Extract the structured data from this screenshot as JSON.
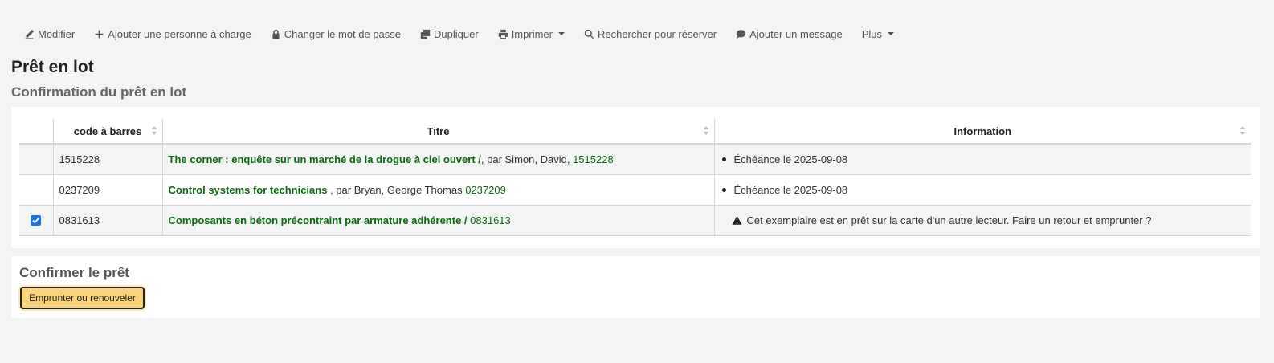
{
  "toolbar": {
    "items": [
      {
        "label": "Modifier",
        "icon": "pencil-icon"
      },
      {
        "label": "Ajouter une personne à charge",
        "icon": "plus-icon"
      },
      {
        "label": "Changer le mot de passe",
        "icon": "lock-icon"
      },
      {
        "label": "Dupliquer",
        "icon": "copy-icon"
      },
      {
        "label": "Imprimer",
        "icon": "print-icon"
      },
      {
        "label": "Rechercher pour réserver",
        "icon": "search-icon"
      },
      {
        "label": "Ajouter un message",
        "icon": "comment-icon"
      },
      {
        "label": "Plus"
      }
    ]
  },
  "page": {
    "title": "Prêt en lot",
    "subtitle": "Confirmation du prêt en lot"
  },
  "table": {
    "headers": [
      "code à barres",
      "Titre",
      "Information"
    ],
    "rows": [
      {
        "checked": false,
        "barcode": "1515228",
        "title": "The corner : enquête sur un marché de la drogue à ciel ouvert /",
        "author": ", par Simon, David,",
        "item_link": "1515228",
        "info": "Échéance le 2025-09-08"
      },
      {
        "checked": false,
        "barcode": "0237209",
        "title": "Control systems for technicians",
        "author": " , par Bryan, George Thomas",
        "item_link": "0237209",
        "info": "Échéance le 2025-09-08"
      },
      {
        "checked": true,
        "barcode": "0831613",
        "title": "Composants en béton précontraint par armature adhérente /",
        "author": "",
        "item_link": "0831613",
        "info": "Cet exemplaire est en prêt sur la carte d'un autre lecteur. Faire un retour et emprunter ?"
      }
    ]
  },
  "confirm": {
    "heading": "Confirmer le prêt",
    "button_label": "Emprunter ou renouveler"
  },
  "colors": {
    "link_green": "#0d6a12",
    "button_yellow": "#fdd37a",
    "checkbox_blue": "#1a73e8"
  }
}
